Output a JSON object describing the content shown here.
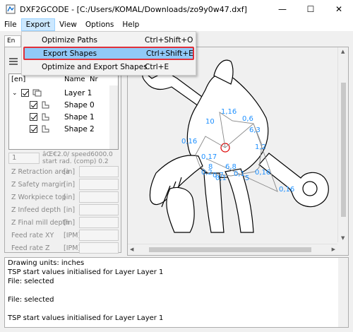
{
  "window": {
    "title": "DXF2GCODE - [C:/Users/KOMAL/Downloads/zo9y0w47.dxf]",
    "minimize": "—",
    "maximize": "☐",
    "close": "✕"
  },
  "menu": {
    "items": [
      "File",
      "Export",
      "View",
      "Options",
      "Help"
    ],
    "active": "Export"
  },
  "export_menu": [
    {
      "label": "Optimize Paths",
      "shortcut": "Ctrl+Shift+O"
    },
    {
      "label": "Export Shapes",
      "shortcut": "Ctrl+Shift+E"
    },
    {
      "label": "Optimize and Export Shapes",
      "shortcut": "Ctrl+E"
    }
  ],
  "left_panel": {
    "tab_label": "En",
    "tree_header": {
      "col1": "[en]",
      "col2": "Name",
      "col3": "Nr"
    },
    "rows": [
      {
        "name": "Layer 1",
        "nr": ""
      },
      {
        "name": "Shape",
        "nr": "0"
      },
      {
        "name": "Shape",
        "nr": "1"
      },
      {
        "name": "Shape",
        "nr": "2"
      }
    ],
    "tool_value": "1",
    "tool_info_1": "âŒ€2.0/ speed6000.0",
    "tool_info_2": "start rad. (comp) 0.2",
    "params": [
      {
        "label": "Z Retraction area",
        "unit": "[in]"
      },
      {
        "label": "Z Safety margin",
        "unit": "[in]"
      },
      {
        "label": "Z Workpiece top",
        "unit": "[in]"
      },
      {
        "label": "Z Infeed depth",
        "unit": "[in]"
      },
      {
        "label": "Z Final mill depth",
        "unit": "[in]"
      },
      {
        "label": "Feed rate XY",
        "unit": "[IPM]"
      },
      {
        "label": "Feed rate Z",
        "unit": "[IPM]"
      }
    ]
  },
  "canvas": {
    "labels": [
      "1,16",
      "10",
      "0,6",
      "0,16",
      "0,17",
      "6,3",
      "1,2",
      "6,8",
      "0,2",
      "0,7",
      "0,1",
      "0,16",
      "5",
      "8",
      "0,1",
      "0,16"
    ]
  },
  "log": {
    "lines": [
      "Drawing units: inches",
      "TSP start values initialised for Layer Layer 1",
      "File:  selected",
      "",
      "File:  selected",
      "",
      "TSP start values initialised for Layer Layer 1"
    ]
  },
  "colors": {
    "highlight": "#91c9f7",
    "highlight_border": "#e0303a",
    "path_label": "#1e90ff",
    "menu_active": "#cce8ff"
  }
}
